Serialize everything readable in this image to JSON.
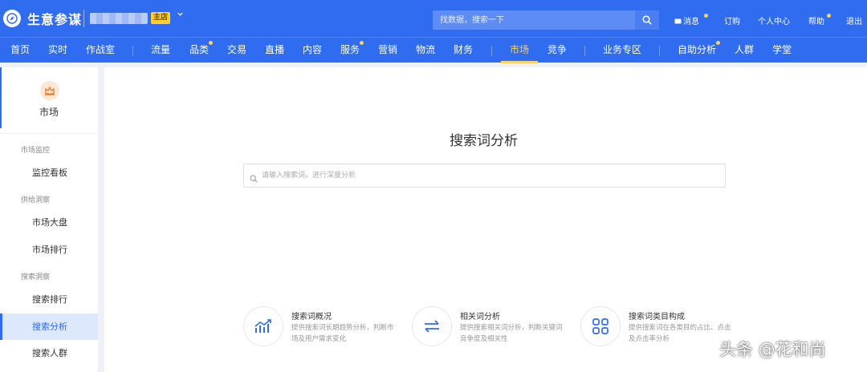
{
  "app": {
    "title": "生意参谋",
    "shop_badge": "主店"
  },
  "top_search": {
    "placeholder": "找数据，搜索一下"
  },
  "top_links": [
    {
      "label": "消息",
      "has_dot": true
    },
    {
      "label": "订购",
      "has_dot": false
    },
    {
      "label": "个人中心",
      "has_dot": false
    },
    {
      "label": "帮助",
      "has_dot": true
    },
    {
      "label": "退出",
      "has_dot": false
    }
  ],
  "nav": {
    "active": "市场",
    "items": [
      {
        "label": "首页"
      },
      {
        "label": "实时"
      },
      {
        "label": "作战室"
      },
      {
        "label": "流量"
      },
      {
        "label": "品类",
        "has_dot": true
      },
      {
        "label": "交易"
      },
      {
        "label": "直播"
      },
      {
        "label": "内容"
      },
      {
        "label": "服务",
        "has_dot": true
      },
      {
        "label": "营销"
      },
      {
        "label": "物流"
      },
      {
        "label": "财务"
      },
      {
        "label": "市场"
      },
      {
        "label": "竞争"
      },
      {
        "label": "业务专区"
      },
      {
        "label": "自助分析",
        "has_dot": true
      },
      {
        "label": "人群"
      },
      {
        "label": "学堂"
      }
    ]
  },
  "sidebar": {
    "head_label": "市场",
    "groups": [
      {
        "title": "市场监控",
        "items": [
          "监控看板"
        ]
      },
      {
        "title": "供给洞察",
        "items": [
          "市场大盘",
          "市场排行"
        ]
      },
      {
        "title": "搜索洞察",
        "items": [
          "搜索排行",
          "搜索分析",
          "搜索人群"
        ]
      }
    ],
    "active_item": "搜索分析"
  },
  "main": {
    "title": "搜索词分析",
    "search_placeholder": "请输入搜索词，进行深度分析",
    "features": [
      {
        "title": "搜索词概况",
        "desc": "提供搜索词长期趋势分析，判断市场及用户需求变化",
        "icon": "trend-chart-icon"
      },
      {
        "title": "相关词分析",
        "desc": "提供搜索相关词分析，判断关键词竞争度及相关性",
        "icon": "swap-arrows-icon"
      },
      {
        "title": "搜索词类目构成",
        "desc": "提供搜索词在各类目的占比、点击及点击率分析",
        "icon": "grid-icon"
      }
    ]
  },
  "watermark": "头条 @花和尚",
  "colors": {
    "brand_blue": "#2f6cf0",
    "active_yellow": "#ffd35a",
    "sidebar_active_bg": "#dde8fd"
  }
}
